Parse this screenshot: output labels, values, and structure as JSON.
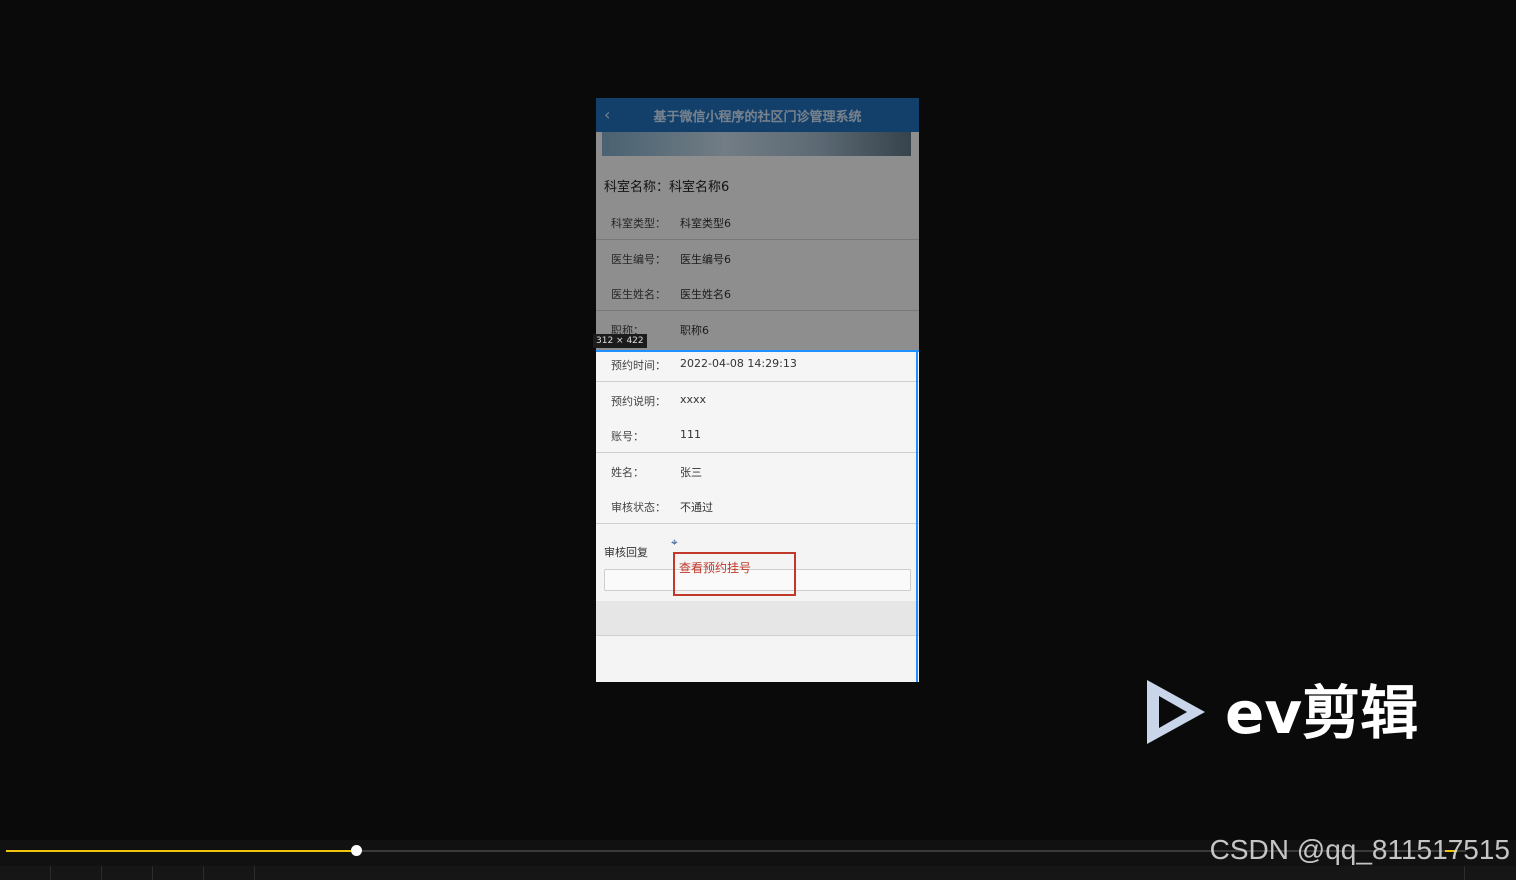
{
  "app": {
    "header_title": "基于微信小程序的社区门诊管理系统",
    "back_icon": "chevron-left-icon",
    "dept_label": "科室名称：",
    "dept_value": "科室名称6"
  },
  "fields": [
    {
      "label": "科室类型：",
      "value": "科室类型6"
    },
    {
      "label": "医生编号：",
      "value": "医生编号6"
    },
    {
      "label": "医生姓名：",
      "value": "医生姓名6"
    },
    {
      "label": "职称：",
      "value": "职称6"
    },
    {
      "label": "预约时间：",
      "value": "2022-04-08 14:29:13"
    },
    {
      "label": "预约说明：",
      "value": "xxxx"
    },
    {
      "label": "账号：",
      "value": "111"
    },
    {
      "label": "姓名：",
      "value": "张三"
    },
    {
      "label": "审核状态：",
      "value": "不通过"
    }
  ],
  "reply": {
    "label": "审核回复",
    "value": ""
  },
  "devtools": {
    "size_badge": "312 × 422"
  },
  "annotation": {
    "text": "查看预约挂号"
  },
  "player": {
    "logo_text": "ev剪辑",
    "progress": 0.24,
    "accent": "#f1c40f"
  },
  "watermark": "CSDN @qq_811517515"
}
